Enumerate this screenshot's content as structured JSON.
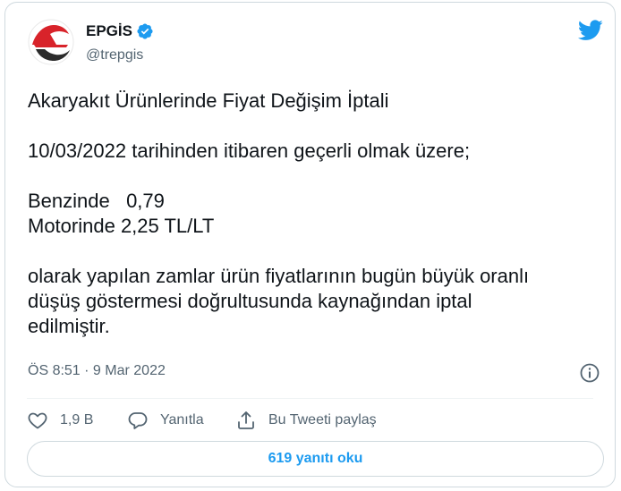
{
  "account": {
    "display_name": "EPGİS",
    "handle": "@trepgis",
    "verified": true
  },
  "tweet": {
    "lines": [
      "Akaryakıt Ürünlerinde Fiyat Değişim İptali",
      "",
      "10/03/2022 tarihinden itibaren geçerli olmak üzere;",
      "",
      "Benzinde   0,79",
      "Motorinde 2,25 TL/LT",
      "",
      "olarak yapılan zamlar ürün fiyatlarının bugün büyük oranlı",
      "düşüş göstermesi doğrultusunda kaynağından iptal",
      "edilmiştir."
    ],
    "time": "ÖS 8:51",
    "separator": " · ",
    "date": "9 Mar 2022"
  },
  "actions": {
    "like_count": "1,9 B",
    "reply_label": "Yanıtla",
    "share_label": "Bu Tweeti paylaş"
  },
  "read_replies_label": "619 yanıtı oku",
  "colors": {
    "accent": "#1d9bf0",
    "text": "#0f1419",
    "secondary": "#536471",
    "border": "#cfd9de",
    "logo_red": "#d8232a",
    "logo_dark": "#2b2b2b"
  },
  "icons": [
    "epgis-logo",
    "verified-badge-icon",
    "twitter-bird-icon",
    "info-icon",
    "heart-icon",
    "reply-icon",
    "share-icon"
  ]
}
